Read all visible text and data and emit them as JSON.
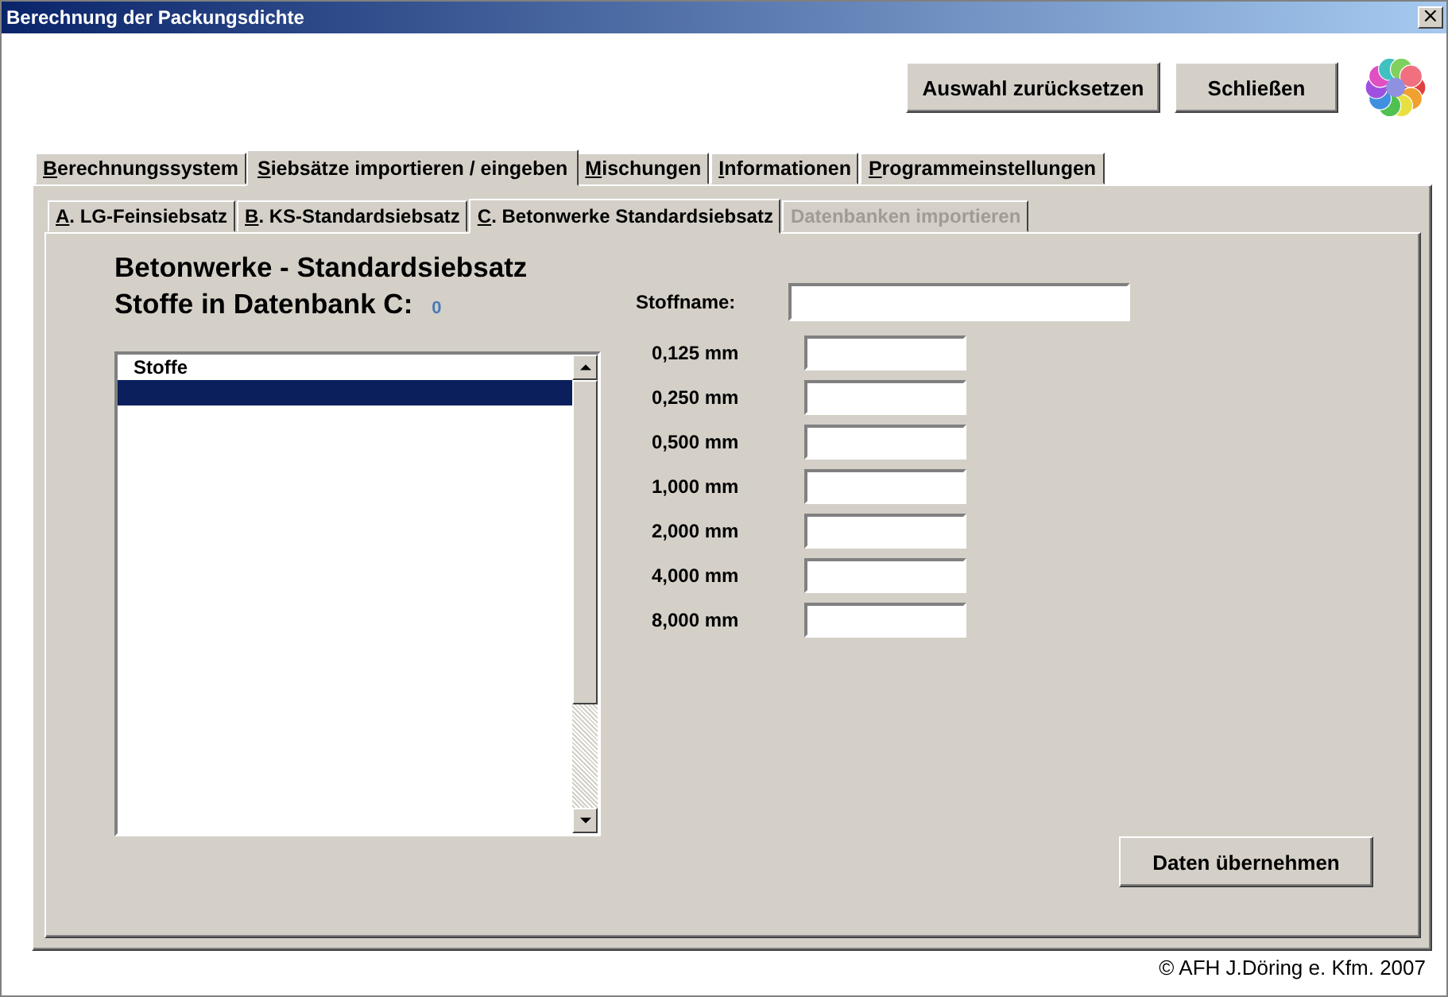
{
  "window": {
    "title": "Berechnung der Packungsdichte",
    "close": "×"
  },
  "top_buttons": [
    "Auswahl zurücksetzen",
    "Schließen"
  ],
  "tabs": [
    {
      "key": "B",
      "rest": "erechnungssystem",
      "selected": false
    },
    {
      "key": "S",
      "rest": "iebsätze importieren / eingeben",
      "selected": true
    },
    {
      "key": "M",
      "rest": "ischungen",
      "selected": false
    },
    {
      "key": "I",
      "rest": "nformationen",
      "selected": false
    },
    {
      "key": "P",
      "rest": "rogrammeinstellungen",
      "selected": false
    }
  ],
  "subtabs": [
    {
      "key": "A",
      "rest": ". LG-Feinsiebsatz",
      "selected": false,
      "disabled": false
    },
    {
      "key": "B",
      "rest": ". KS-Standardsiebsatz",
      "selected": false,
      "disabled": false
    },
    {
      "key": "C",
      "rest": ". Betonwerke Standardsiebsatz",
      "selected": true,
      "disabled": false
    },
    {
      "rest": "Datenbanken importieren",
      "selected": false,
      "disabled": true
    }
  ],
  "heading": "Betonwerke - Standardsiebsatz",
  "count_label": "Stoffe in Datenbank C:",
  "count": "0",
  "list": {
    "header": "Stoffe",
    "rows": [
      {
        "selected": true
      }
    ]
  },
  "form": {
    "name_label": "Stoffname:",
    "sieves": [
      "0,125 mm",
      "0,250 mm",
      "0,500 mm",
      "1,000 mm",
      "2,000 mm",
      "4,000 mm",
      "8,000 mm"
    ]
  },
  "apply_button": "Daten übernehmen",
  "footer": "© AFH J.Döring e. Kfm. 2007"
}
